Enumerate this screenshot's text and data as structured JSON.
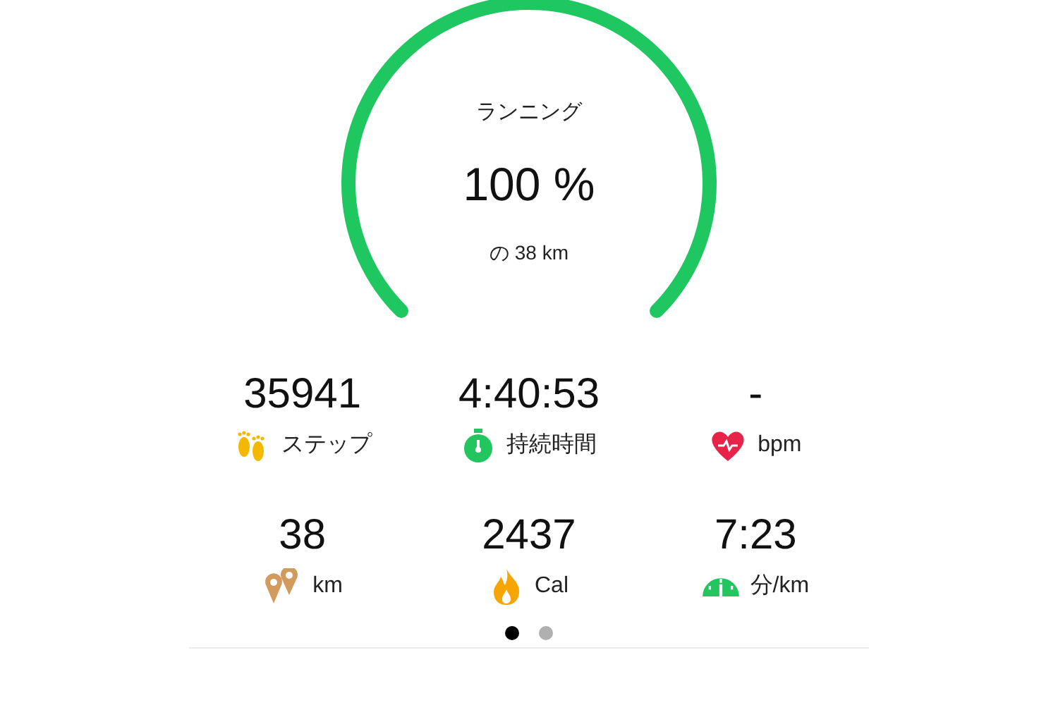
{
  "ring": {
    "title": "ランニング",
    "value": "100 %",
    "goal": "の 38 km"
  },
  "stats": [
    {
      "value": "35941",
      "unit": "ステップ",
      "kind": "steps"
    },
    {
      "value": "4:40:53",
      "unit": "持続時間",
      "kind": "timer"
    },
    {
      "value": "-",
      "unit": "bpm",
      "kind": "heart"
    },
    {
      "value": "38",
      "unit": "km",
      "kind": "pins"
    },
    {
      "value": "2437",
      "unit": "Cal",
      "kind": "flame"
    },
    {
      "value": "7:23",
      "unit": "分/km",
      "kind": "speed"
    }
  ],
  "pages": [
    {
      "selected": true
    },
    {
      "selected": false
    }
  ]
}
